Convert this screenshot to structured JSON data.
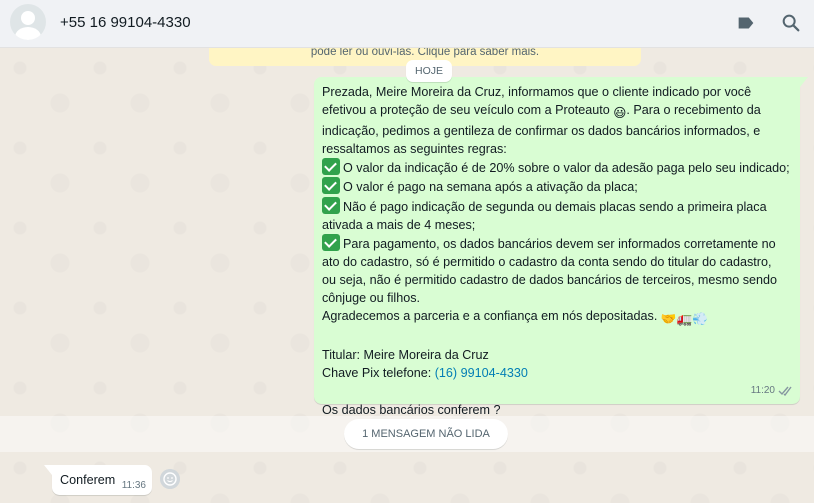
{
  "header": {
    "contact": "+55 16 99104-4330",
    "icons": [
      "label-icon",
      "search-icon"
    ]
  },
  "encryption_note": "pode ler ou ouvi-las. Clique para saber mais.",
  "date_chip": "HOJE",
  "outgoing": {
    "lines": [
      "Prezada, Meire Moreira da Cruz, informamos que o cliente indicado por você",
      "efetivou a proteção de seu veículo com a Proteauto",
      ". Para o recebimento da",
      "indicação, pedimos a gentileza de confirmar os dados bancários informados, e",
      "ressaltamos as seguintes regras:",
      "O valor da indicação é de 20% sobre o valor da adesão paga pelo seu indicado;",
      "O valor é pago na semana após a ativação da placa;",
      "Não é pago indicação de segunda ou demais placas sendo a primeira placa",
      "ativada a mais de 4 meses;",
      "Para pagamento, os dados bancários devem ser informados corretamente no",
      "ato do cadastro, só é permitido o cadastro da conta sendo do titular do cadastro,",
      "ou seja, não é permitido cadastro de dados bancários de terceiros, mesmo sendo",
      "cônjuge ou filhos.",
      "Agradecemos a parceria e a confiança em nós depositadas.",
      "Titular: Meire Moreira da Cruz",
      "Chave Pix telefone: ",
      "(16) 99104-4330",
      "Os dados bancários conferem ?"
    ],
    "emojis": {
      "smile": "😃",
      "sign_off": "🤝🚛💨"
    },
    "time": "11:20"
  },
  "unread_banner": "1 MENSAGEM NÃO LIDA",
  "incoming": {
    "text": "Conferem",
    "time": "11:36"
  },
  "colors": {
    "outgoing_bubble": "#d9fdd3",
    "incoming_bubble": "#ffffff",
    "header_bg": "#f0f2f5",
    "chat_bg": "#efeae2",
    "link": "#027eb5",
    "check_green": "#31a24c"
  }
}
